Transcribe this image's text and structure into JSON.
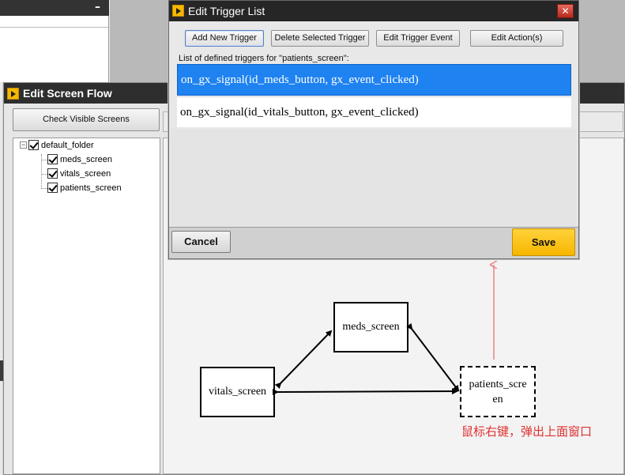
{
  "background": {
    "minimize_label": "–"
  },
  "screen_flow": {
    "title": "Edit Screen Flow",
    "check_visible_label": "Check Visible Screens",
    "tree": {
      "folder": "default_folder",
      "expander": "−",
      "screens": [
        "meds_screen",
        "vitals_screen",
        "patients_screen"
      ]
    },
    "nodes": {
      "meds": "meds_screen",
      "vitals": "vitals_screen",
      "patients": "patients_scre en"
    }
  },
  "trigger_dialog": {
    "title": "Edit Trigger List",
    "close_label": "✕",
    "buttons": {
      "add": "Add New Trigger",
      "delete": "Delete Selected Trigger",
      "edit_event": "Edit Trigger Event",
      "edit_action": "Edit Action(s)"
    },
    "list_caption": "List of defined triggers for \"patients_screen\":",
    "triggers": [
      "on_gx_signal(id_meds_button, gx_event_clicked)",
      "on_gx_signal(id_vitals_button, gx_event_clicked)"
    ],
    "selected_index": 0,
    "cancel_label": "Cancel",
    "save_label": "Save"
  },
  "annotation": {
    "text": "鼠标右键，弹出上面窗口",
    "color": "#e03030"
  },
  "colors": {
    "selection": "#1e82f0",
    "save_button": "#f6b600",
    "title_bar": "#262626"
  }
}
